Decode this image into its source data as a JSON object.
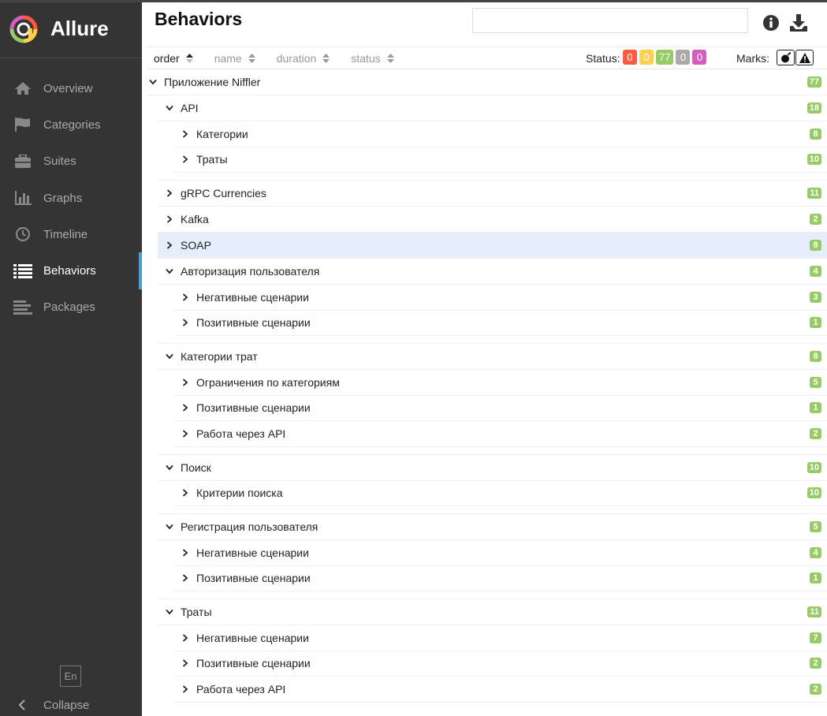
{
  "app": {
    "name": "Allure"
  },
  "sidebar": {
    "items": [
      {
        "label": "Overview",
        "icon": "home-icon",
        "active": false
      },
      {
        "label": "Categories",
        "icon": "flag-icon",
        "active": false
      },
      {
        "label": "Suites",
        "icon": "briefcase-icon",
        "active": false
      },
      {
        "label": "Graphs",
        "icon": "bar-chart-icon",
        "active": false
      },
      {
        "label": "Timeline",
        "icon": "clock-icon",
        "active": false
      },
      {
        "label": "Behaviors",
        "icon": "list-icon",
        "active": true
      },
      {
        "label": "Packages",
        "icon": "align-left-icon",
        "active": false
      }
    ],
    "language": "En",
    "collapse_label": "Collapse"
  },
  "page": {
    "title": "Behaviors",
    "search_value": ""
  },
  "toolbar": {
    "sort": {
      "order": "order",
      "name": "name",
      "duration": "duration",
      "status": "status"
    },
    "status_label": "Status:",
    "status_counts": [
      {
        "key": "failed",
        "value": "0",
        "color": "#fd5a3e"
      },
      {
        "key": "broken",
        "value": "0",
        "color": "#ffd050"
      },
      {
        "key": "passed",
        "value": "77",
        "color": "#97cc64"
      },
      {
        "key": "skipped",
        "value": "0",
        "color": "#aaaaaa"
      },
      {
        "key": "unknown",
        "value": "0",
        "color": "#d35ebe"
      }
    ],
    "marks_label": "Marks:"
  },
  "tree": [
    {
      "level": 0,
      "label": "Приложение Niffler",
      "count": "77",
      "expanded": true
    },
    {
      "level": 1,
      "label": "API",
      "count": "18",
      "expanded": true
    },
    {
      "level": 2,
      "label": "Категории",
      "count": "8",
      "expanded": false
    },
    {
      "level": 2,
      "label": "Траты",
      "count": "10",
      "expanded": false
    },
    {
      "gap": true
    },
    {
      "level": 1,
      "label": "gRPC Currencies",
      "count": "11",
      "expanded": false
    },
    {
      "level": 1,
      "label": "Kafka",
      "count": "2",
      "expanded": false
    },
    {
      "level": 1,
      "label": "SOAP",
      "count": "8",
      "expanded": false,
      "selected": true
    },
    {
      "level": 1,
      "label": "Авторизация пользователя",
      "count": "4",
      "expanded": true
    },
    {
      "level": 2,
      "label": "Негативные сценарии",
      "count": "3",
      "expanded": false
    },
    {
      "level": 2,
      "label": "Позитивные сценарии",
      "count": "1",
      "expanded": false
    },
    {
      "gap": true
    },
    {
      "level": 1,
      "label": "Категории трат",
      "count": "8",
      "expanded": true
    },
    {
      "level": 2,
      "label": "Ограничения по категориям",
      "count": "5",
      "expanded": false
    },
    {
      "level": 2,
      "label": "Позитивные сценарии",
      "count": "1",
      "expanded": false
    },
    {
      "level": 2,
      "label": "Работа через API",
      "count": "2",
      "expanded": false
    },
    {
      "gap": true
    },
    {
      "level": 1,
      "label": "Поиск",
      "count": "10",
      "expanded": true
    },
    {
      "level": 2,
      "label": "Критерии поиска",
      "count": "10",
      "expanded": false
    },
    {
      "gap": true
    },
    {
      "level": 1,
      "label": "Регистрация пользователя",
      "count": "5",
      "expanded": true
    },
    {
      "level": 2,
      "label": "Негативные сценарии",
      "count": "4",
      "expanded": false
    },
    {
      "level": 2,
      "label": "Позитивные сценарии",
      "count": "1",
      "expanded": false
    },
    {
      "gap": true
    },
    {
      "level": 1,
      "label": "Траты",
      "count": "11",
      "expanded": true
    },
    {
      "level": 2,
      "label": "Негативные сценарии",
      "count": "7",
      "expanded": false
    },
    {
      "level": 2,
      "label": "Позитивные сценарии",
      "count": "2",
      "expanded": false
    },
    {
      "level": 2,
      "label": "Работа через API",
      "count": "2",
      "expanded": false
    }
  ]
}
